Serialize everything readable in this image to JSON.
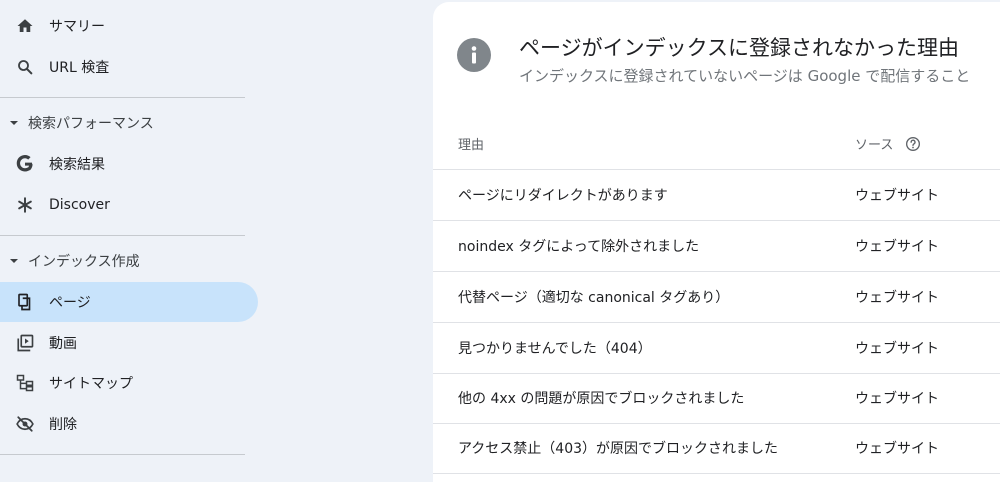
{
  "sidebar": {
    "items_top": [
      {
        "label": "サマリー",
        "icon": "home-icon"
      },
      {
        "label": "URL 検査",
        "icon": "search-icon"
      }
    ],
    "section_performance": {
      "label": "検索パフォーマンス",
      "items": [
        {
          "label": "検索結果",
          "icon": "google-icon"
        },
        {
          "label": "Discover",
          "icon": "asterisk-icon"
        }
      ]
    },
    "section_index": {
      "label": "インデックス作成",
      "items": [
        {
          "label": "ページ",
          "icon": "pages-icon",
          "active": true
        },
        {
          "label": "動画",
          "icon": "video-icon"
        },
        {
          "label": "サイトマップ",
          "icon": "sitemap-icon"
        },
        {
          "label": "削除",
          "icon": "removal-icon"
        }
      ]
    }
  },
  "card": {
    "title": "ページがインデックスに登録されなかった理由",
    "subtitle": "インデックスに登録されていないページは Google で配信すること",
    "table": {
      "col_reason": "理由",
      "col_source": "ソース",
      "rows": [
        {
          "reason": "ページにリダイレクトがあります",
          "source": "ウェブサイト"
        },
        {
          "reason": "noindex タグによって除外されました",
          "source": "ウェブサイト"
        },
        {
          "reason": "代替ページ（適切な canonical タグあり）",
          "source": "ウェブサイト"
        },
        {
          "reason": "見つかりませんでした（404）",
          "source": "ウェブサイト"
        },
        {
          "reason": "他の 4xx の問題が原因でブロックされました",
          "source": "ウェブサイト"
        },
        {
          "reason": "アクセス禁止（403）が原因でブロックされました",
          "source": "ウェブサイト"
        }
      ]
    }
  },
  "colors": {
    "background": "#eef2f8",
    "active_nav": "#c8e3fb",
    "card": "#ffffff",
    "info_icon": "#80868b"
  }
}
